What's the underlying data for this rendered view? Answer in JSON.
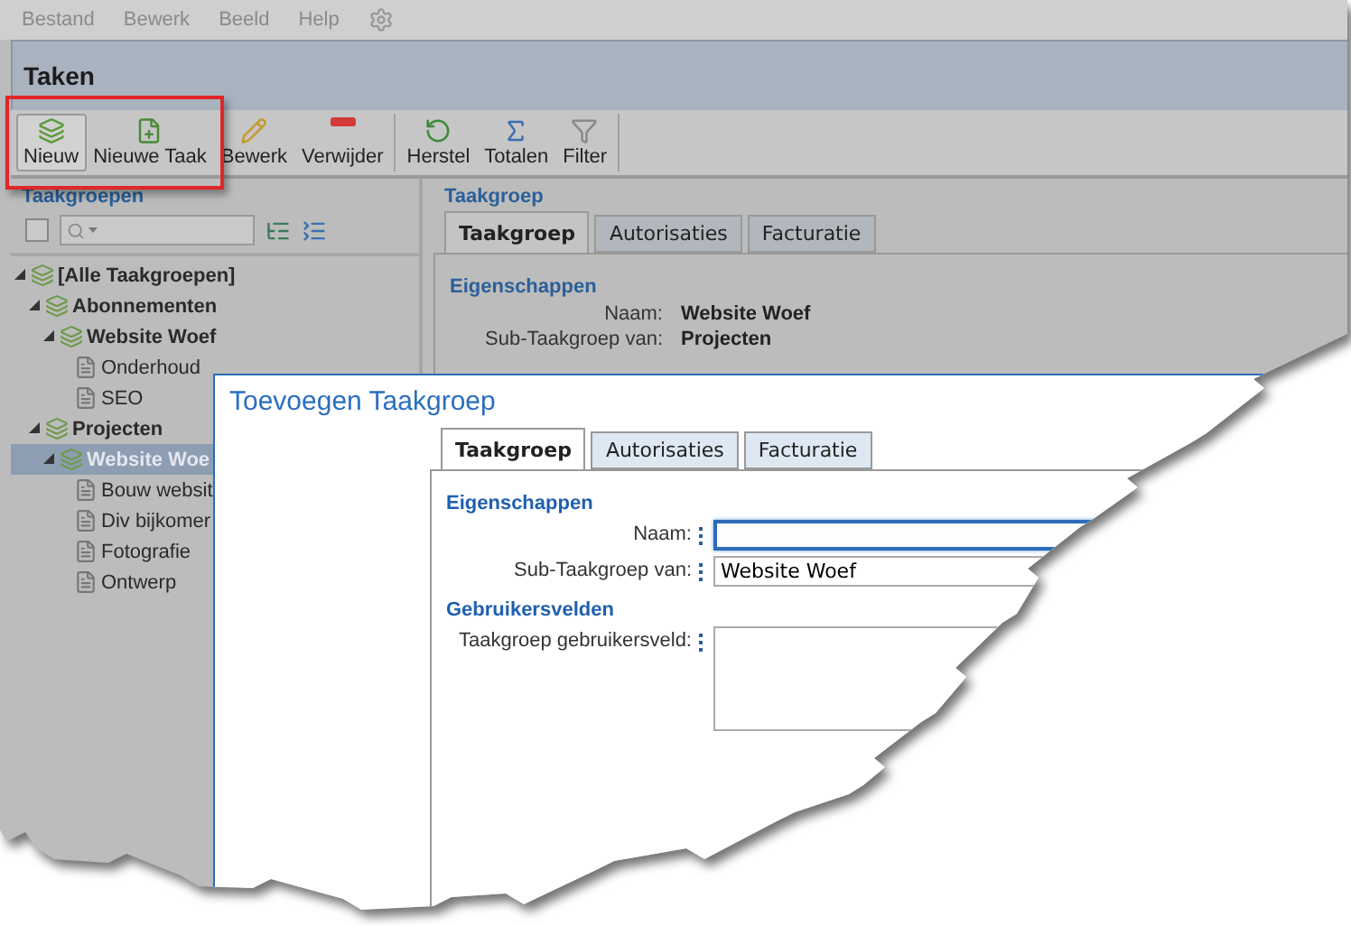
{
  "menu": [
    "Bestand",
    "Bewerk",
    "Beeld",
    "Help"
  ],
  "title": "Taken",
  "toolbar": [
    [
      {
        "label": "Nieuw",
        "pressed": true,
        "highlighted": true
      },
      {
        "label": "Nieuwe Taak",
        "pressed": false,
        "highlighted": true
      },
      {
        "label": "Bewerk",
        "pressed": false,
        "highlighted": false
      },
      {
        "label": "Verwijder",
        "pressed": false,
        "highlighted": false
      }
    ],
    [
      {
        "label": "Herstel",
        "pressed": false,
        "highlighted": false
      },
      {
        "label": "Totalen",
        "pressed": false,
        "highlighted": false
      },
      {
        "label": "Filter",
        "pressed": false,
        "highlighted": false
      }
    ]
  ],
  "left_panel": {
    "title": "Taakgroepen",
    "select_all": {
      "checked": false
    },
    "tree": [
      {
        "label": "[Alle Taakgroepen]",
        "kind": "group",
        "expanded": true,
        "selected": false,
        "children": [
          {
            "label": "Abonnementen",
            "kind": "group",
            "expanded": true,
            "selected": false,
            "children": [
              {
                "label": "Website Woef",
                "kind": "group",
                "expanded": true,
                "selected": false,
                "children": [
                  {
                    "label": "Onderhoud",
                    "kind": "task",
                    "selected": false
                  },
                  {
                    "label": "SEO",
                    "kind": "task",
                    "selected": false
                  }
                ]
              }
            ]
          },
          {
            "label": "Projecten",
            "kind": "group",
            "expanded": true,
            "selected": false,
            "children": [
              {
                "label": "Website Woe",
                "kind": "group",
                "expanded": true,
                "selected": true,
                "children": [
                  {
                    "label": "Bouw websit",
                    "kind": "task",
                    "selected": false
                  },
                  {
                    "label": "Div bijkomer",
                    "kind": "task",
                    "selected": false
                  },
                  {
                    "label": "Fotografie",
                    "kind": "task",
                    "selected": false
                  },
                  {
                    "label": "Ontwerp",
                    "kind": "task",
                    "selected": false
                  }
                ]
              }
            ]
          }
        ]
      }
    ]
  },
  "right_panel": {
    "title": "Taakgroep",
    "tabs": [
      {
        "label": "Taakgroep",
        "selected": true
      },
      {
        "label": "Autorisaties",
        "selected": false
      },
      {
        "label": "Facturatie",
        "selected": false
      }
    ],
    "section": "Eigenschappen",
    "fields": [
      {
        "label": "Naam:",
        "value": "Website Woef"
      },
      {
        "label": "Sub-Taakgroep van:",
        "value": "Projecten"
      }
    ]
  },
  "dialog": {
    "title": "Toevoegen Taakgroep",
    "tabs": [
      {
        "label": "Taakgroep",
        "selected": true
      },
      {
        "label": "Autorisaties",
        "selected": false
      },
      {
        "label": "Facturatie",
        "selected": false
      }
    ],
    "sections": [
      {
        "title": "Eigenschappen",
        "fields": [
          {
            "label": "Naam:",
            "kind": "input",
            "focused": true
          },
          {
            "label": "Sub-Taakgroep van:",
            "kind": "input",
            "value": "Website Woef",
            "focused": false
          }
        ]
      },
      {
        "title": "Gebruikersvelden",
        "fields": [
          {
            "label": "Taakgroep gebruikersveld:",
            "kind": "textarea"
          }
        ]
      }
    ]
  }
}
